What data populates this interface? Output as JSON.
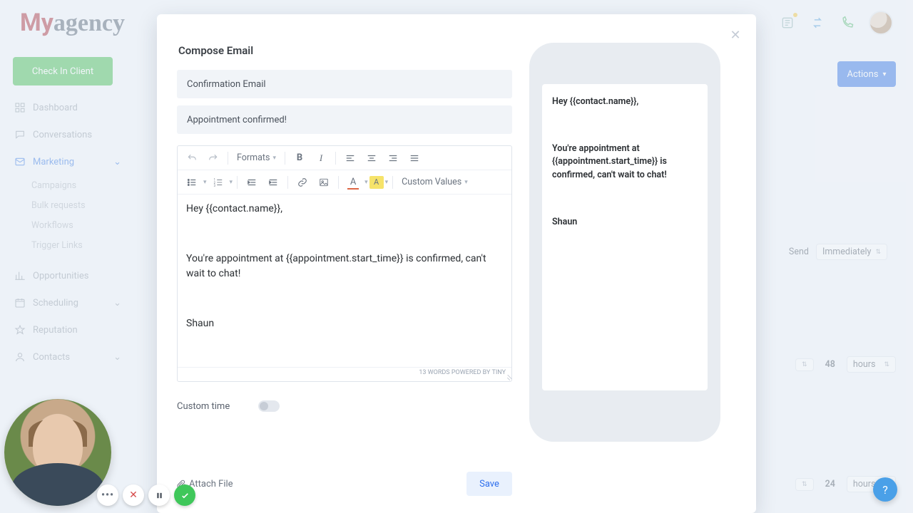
{
  "brand": {
    "my": "My",
    "agency": "agency"
  },
  "top": {
    "checkClient": "Check In Client"
  },
  "sidebar": {
    "items": [
      {
        "label": "Dashboard"
      },
      {
        "label": "Conversations"
      },
      {
        "label": "Marketing"
      },
      {
        "label": "Opportunities"
      },
      {
        "label": "Scheduling"
      },
      {
        "label": "Reputation"
      },
      {
        "label": "Contacts"
      }
    ],
    "marketingSub": [
      {
        "label": "Campaigns"
      },
      {
        "label": "Bulk requests"
      },
      {
        "label": "Workflows"
      },
      {
        "label": "Trigger Links"
      }
    ]
  },
  "bg": {
    "actions": "Actions",
    "sendLabel": "Send",
    "immediately": "Immediately",
    "rows": [
      {
        "num": "48",
        "unit": "hours"
      },
      {
        "num": "24",
        "unit": "hours"
      }
    ]
  },
  "modal": {
    "title": "Compose Email",
    "emailName": "Confirmation Email",
    "subject": "Appointment confirmed!",
    "toolbar": {
      "formats": "Formats",
      "customValues": "Custom Values"
    },
    "body": {
      "line1": "Hey {{contact.name}},",
      "line2": "You're appointment at {{appointment.start_time}} is confirmed, can't wait to chat!",
      "line3": "Shaun"
    },
    "footer": "13 WORDS POWERED BY TINY",
    "customTime": "Custom time",
    "attach": "Attach File",
    "save": "Save"
  },
  "preview": {
    "line1": "Hey {{contact.name}},",
    "line2a": "You're appointment at",
    "line2b": "{{appointment.start_time}} is confirmed, can't wait to chat!",
    "line3": "Shaun"
  },
  "help": "?"
}
